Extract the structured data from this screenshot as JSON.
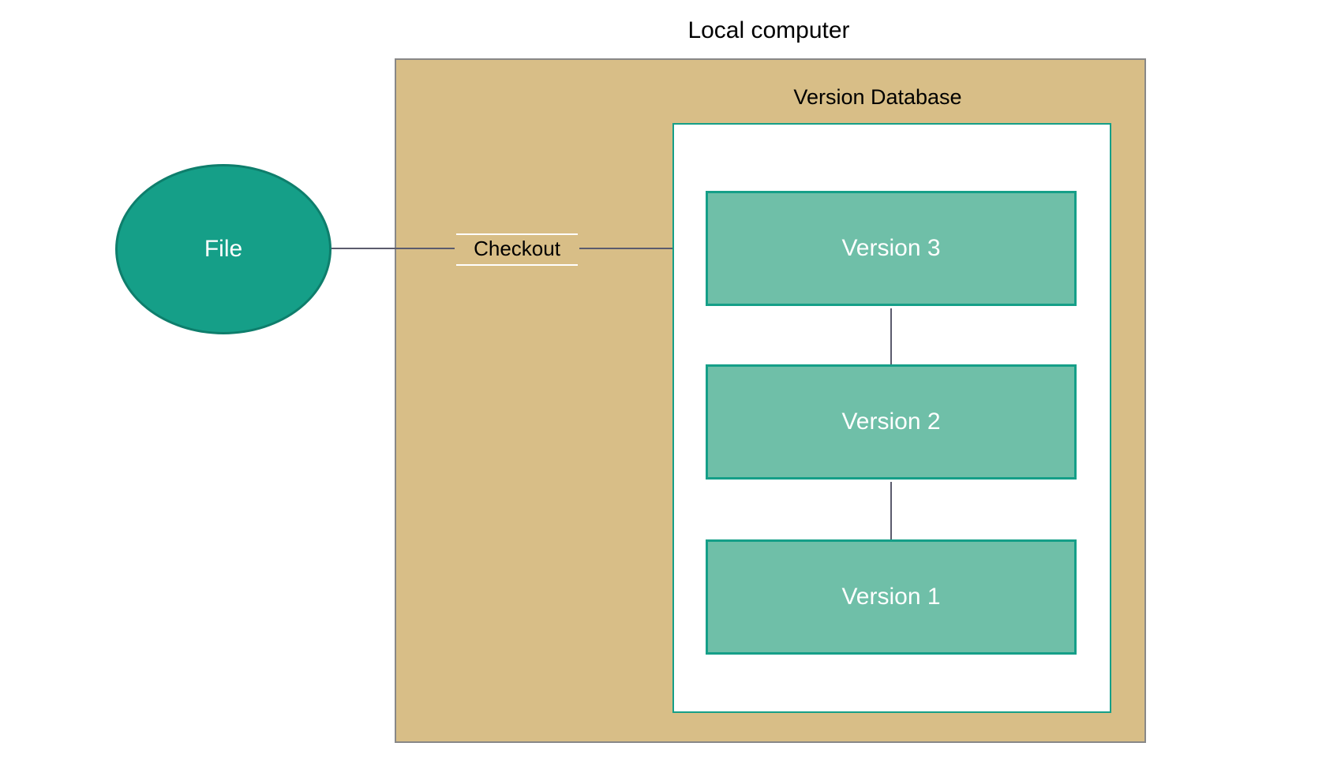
{
  "title": "Local computer",
  "file": {
    "label": "File"
  },
  "edge": {
    "checkout": "Checkout"
  },
  "database": {
    "title": "Version Database",
    "versions": [
      "Version 3",
      "Version 2",
      "Version 1"
    ]
  }
}
